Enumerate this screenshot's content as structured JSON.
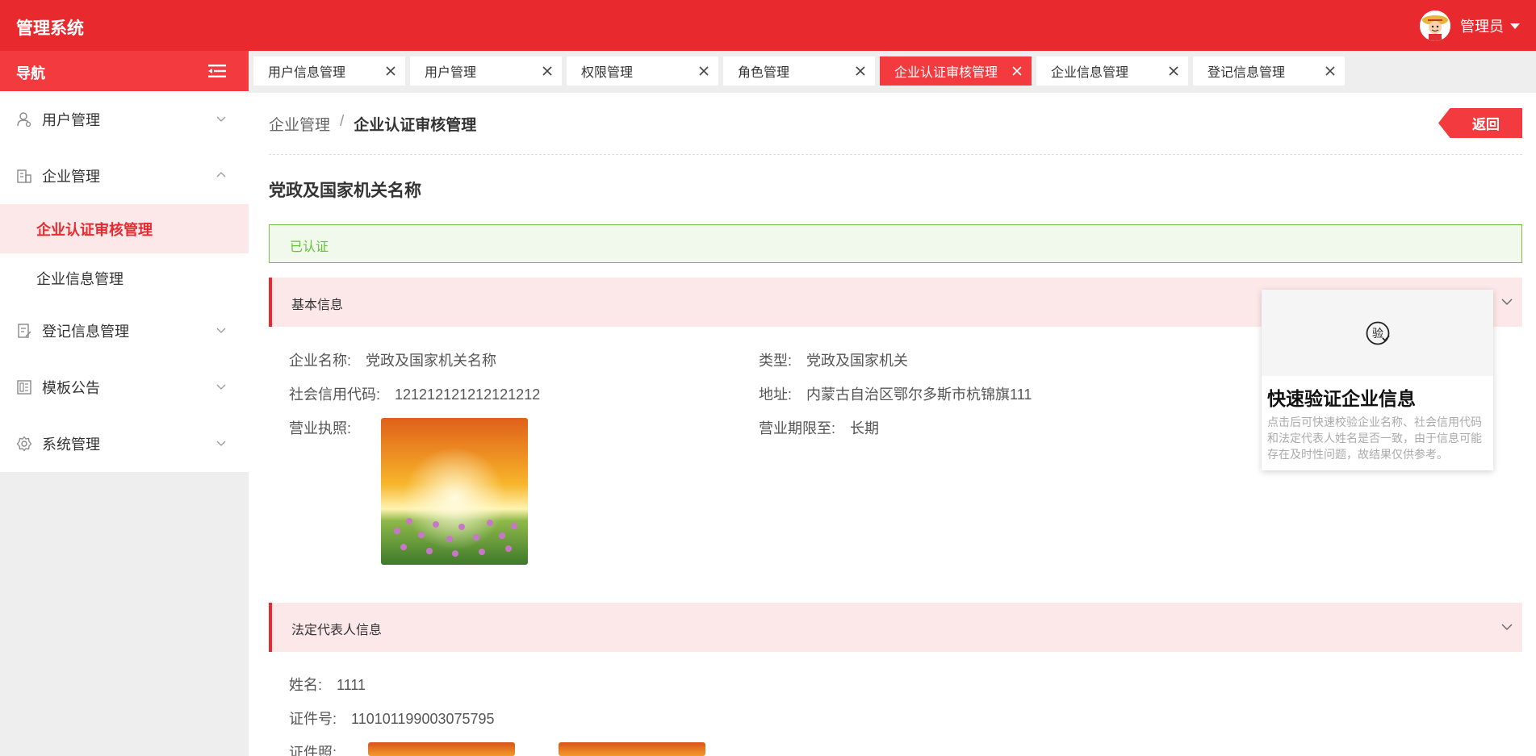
{
  "app": {
    "title": "管理系统",
    "user": "管理员"
  },
  "sidebar": {
    "title": "导航",
    "items": [
      {
        "label": "用户管理",
        "icon": "user-icon"
      },
      {
        "label": "企业管理",
        "icon": "building-icon"
      },
      {
        "label": "登记信息管理",
        "icon": "register-icon"
      },
      {
        "label": "模板公告",
        "icon": "template-icon"
      },
      {
        "label": "系统管理",
        "icon": "gear-icon"
      }
    ],
    "subitems": [
      {
        "label": "企业认证审核管理",
        "active": true
      },
      {
        "label": "企业信息管理",
        "active": false
      }
    ]
  },
  "tabs": [
    {
      "label": "用户信息管理"
    },
    {
      "label": "用户管理"
    },
    {
      "label": "权限管理"
    },
    {
      "label": "角色管理"
    },
    {
      "label": "企业认证审核管理",
      "active": true
    },
    {
      "label": "企业信息管理"
    },
    {
      "label": "登记信息管理"
    }
  ],
  "breadcrumb": {
    "parent": "企业管理",
    "separator": "/",
    "current": "企业认证审核管理"
  },
  "back_label": "返回",
  "org_title": "党政及国家机关名称",
  "status": "已认证",
  "basic": {
    "title": "基本信息",
    "name_label": "企业名称:",
    "name": "党政及国家机关名称",
    "type_label": "类型:",
    "type": "党政及国家机关",
    "code_label": "社会信用代码:",
    "code": "121212121212121212",
    "addr_label": "地址:",
    "addr": "内蒙古自治区鄂尔多斯市杭锦旗111",
    "license_label": "营业执照:",
    "term_label": "营业期限至:",
    "term": "长期"
  },
  "legal": {
    "title": "法定代表人信息",
    "name_label": "姓名:",
    "name": "1111",
    "id_label": "证件号:",
    "id": "110101199003075795",
    "photo_label": "证件照:"
  },
  "verify": {
    "icon_text": "验",
    "title": "快速验证企业信息",
    "desc": "点击后可快速校验企业名称、社会信用代码和法定代表人姓名是否一致，由于信息可能存在及时性问题，故结果仅供参考。"
  },
  "colors": {
    "primary": "#e8292e",
    "sidebar_bg": "#eeeeee",
    "success": "#67c23a"
  }
}
